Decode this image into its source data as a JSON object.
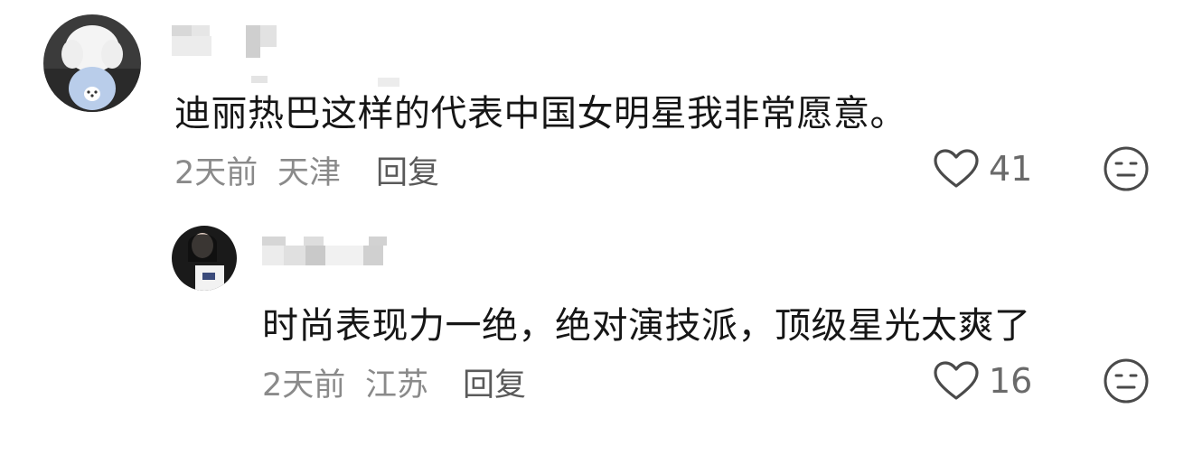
{
  "comments": [
    {
      "text": "迪丽热巴这样的代表中国女明星我非常愿意。",
      "time": "2天前",
      "location": "天津",
      "reply_label": "回复",
      "likes": "41",
      "avatar_icon": "dog-avatar-icon"
    },
    {
      "text": "时尚表现力一绝，绝对演技派，顶级星光太爽了",
      "time": "2天前",
      "location": "江苏",
      "reply_label": "回复",
      "likes": "16",
      "avatar_icon": "girl-avatar-icon"
    }
  ],
  "icons": {
    "like": "heart-outline-icon",
    "dislike": "neutral-face-icon"
  },
  "colors": {
    "text_primary": "#161616",
    "text_meta": "#8a8a8a",
    "reply": "#5a5a5a",
    "icon": "#4a4a4a"
  }
}
